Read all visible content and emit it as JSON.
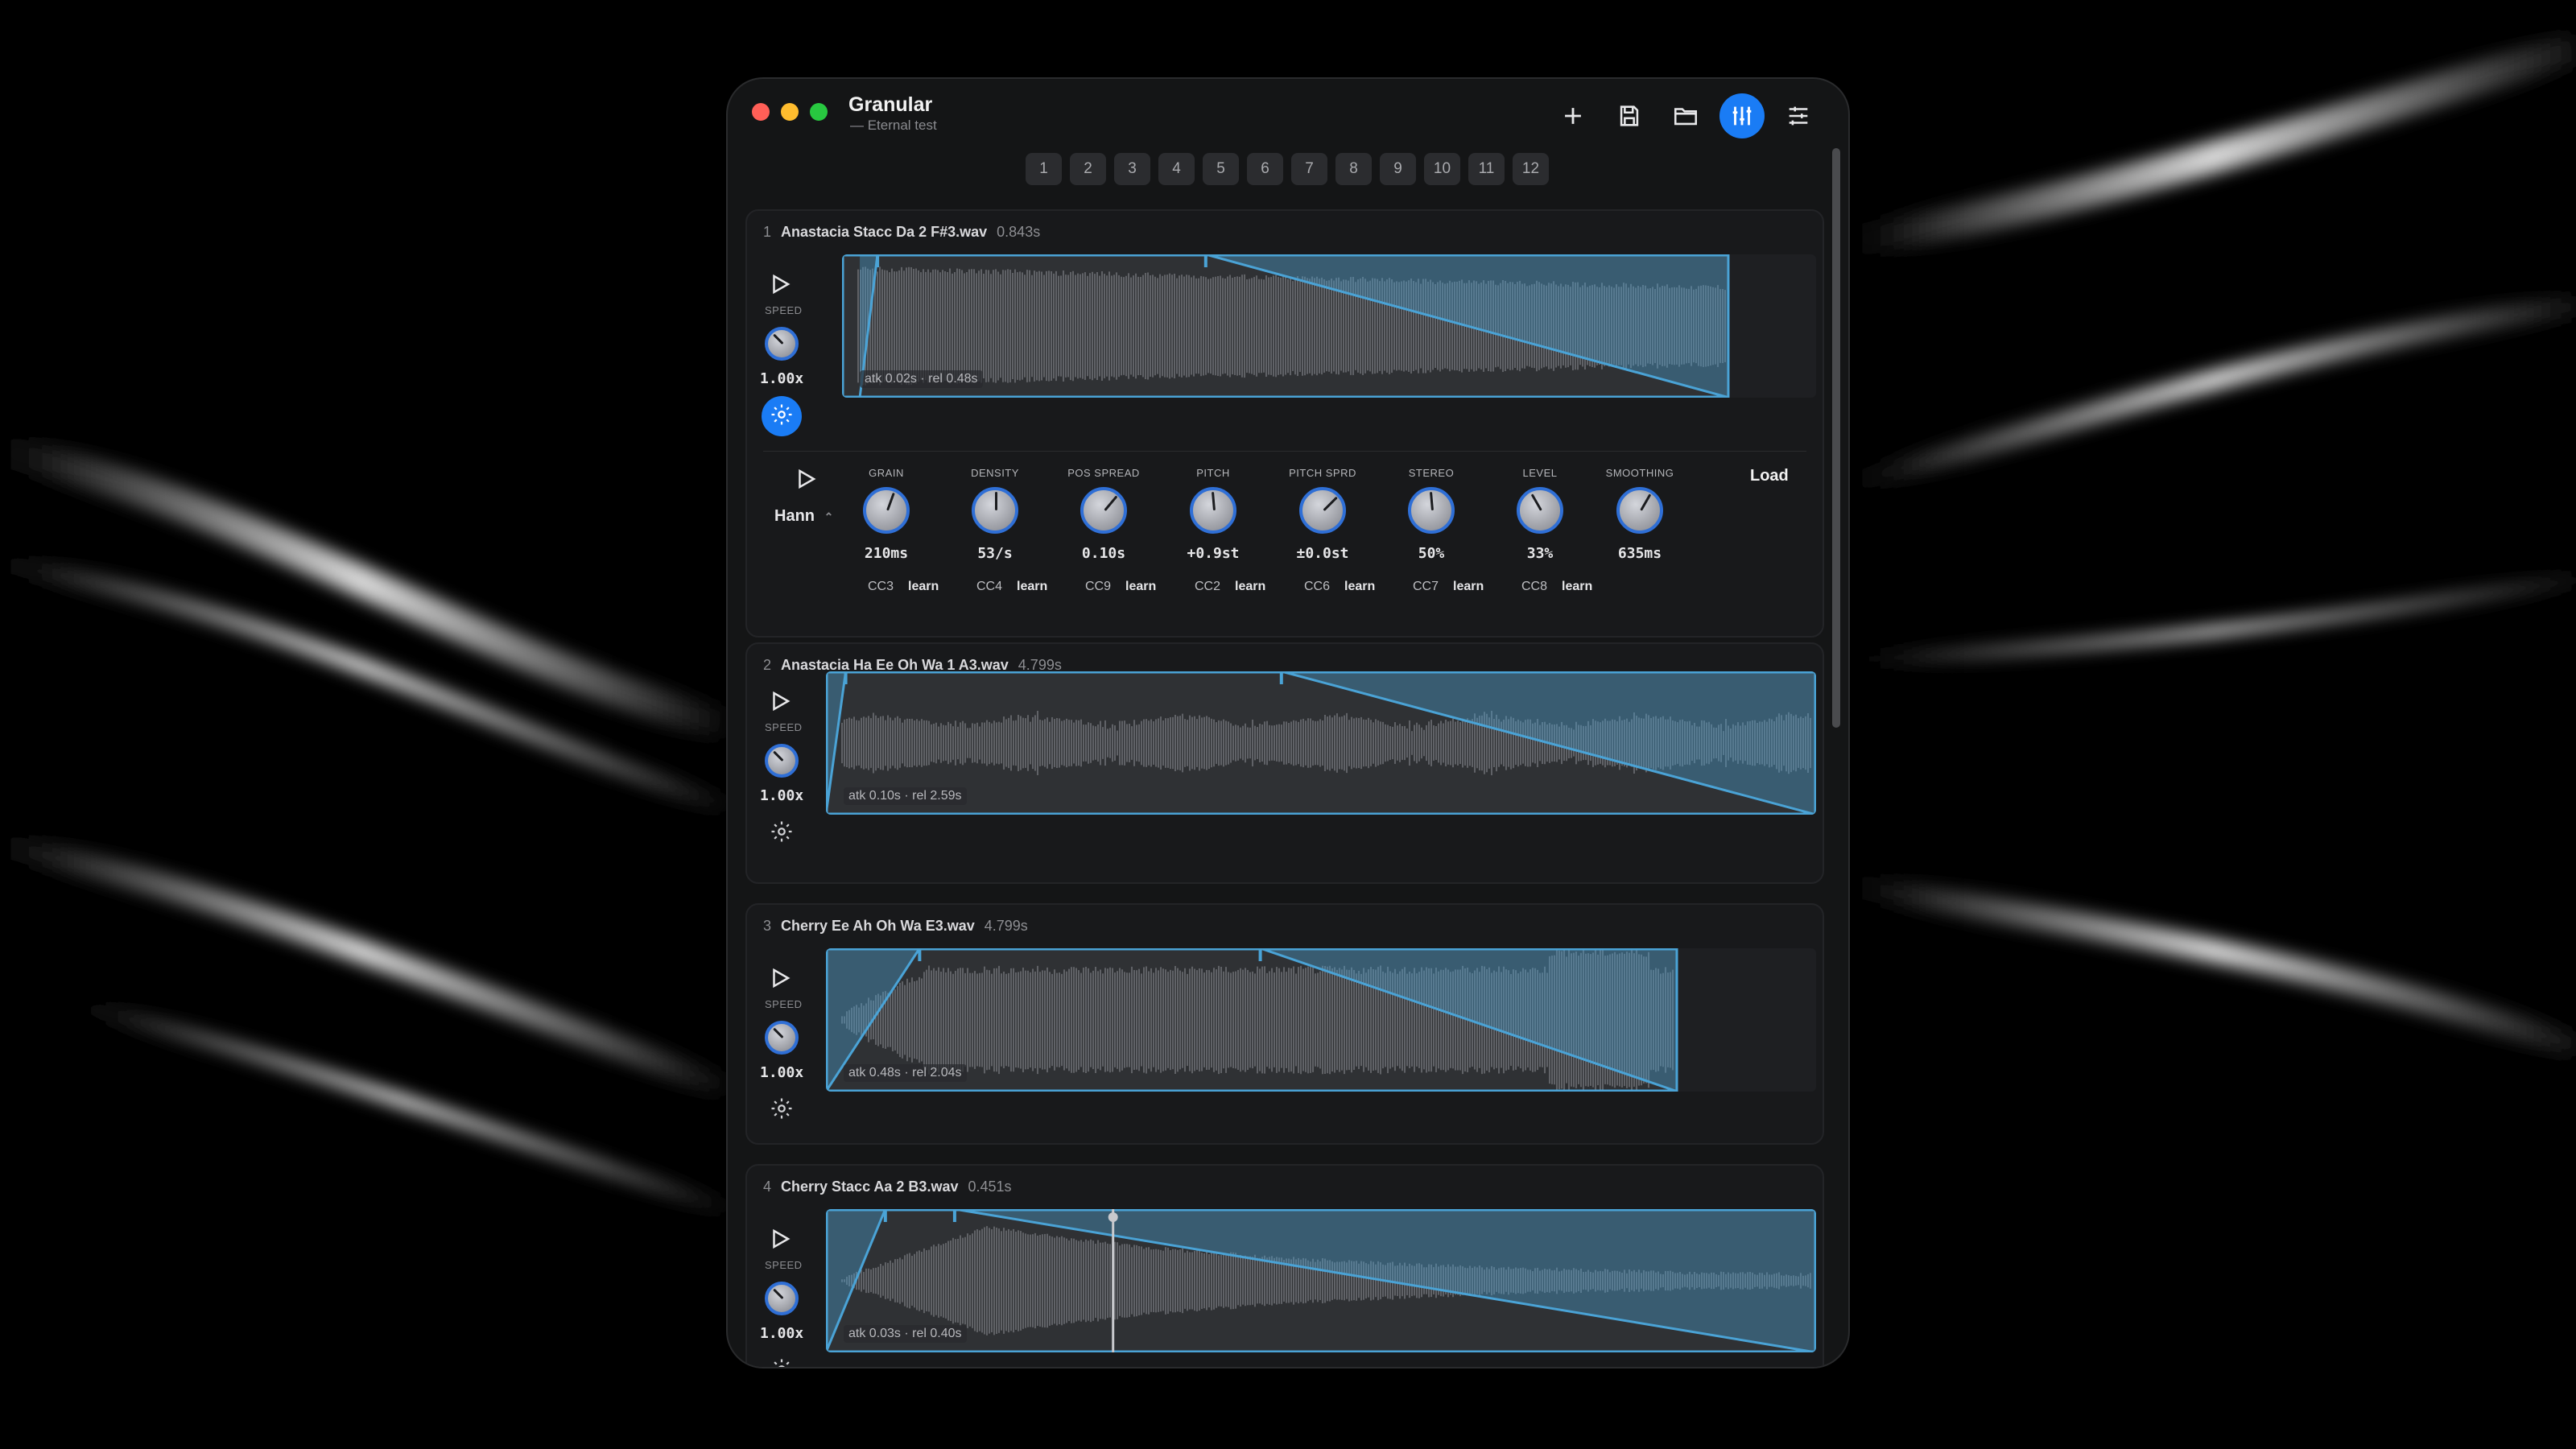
{
  "window": {
    "title": "Granular",
    "subtitle": "— Eternal test"
  },
  "toolbar": {
    "add_icon": "plus-icon",
    "save_icon": "save-icon",
    "open_icon": "folder-icon",
    "mixer_icon": "mixer-icon",
    "settings_icon": "sliders-icon"
  },
  "tabs": [
    "1",
    "2",
    "3",
    "4",
    "5",
    "6",
    "7",
    "8",
    "9",
    "10",
    "11",
    "12"
  ],
  "speed_label": "SPEED",
  "tracks": [
    {
      "num": "1",
      "name": "Anastacia Stacc Da 2 F#3.wav",
      "duration": "0.843s",
      "speed": "1.00x",
      "envelope": "atk 0.02s · rel 0.48s",
      "gear_active": true
    },
    {
      "num": "2",
      "name": "Anastacia Ha Ee Oh Wa 1 A3.wav",
      "duration": "4.799s",
      "speed": "1.00x",
      "envelope": "atk 0.10s · rel 2.59s",
      "gear_active": false
    },
    {
      "num": "3",
      "name": "Cherry Ee Ah Oh Wa E3.wav",
      "duration": "4.799s",
      "speed": "1.00x",
      "envelope": "atk 0.48s · rel 2.04s",
      "gear_active": false
    },
    {
      "num": "4",
      "name": "Cherry Stacc Aa 2 B3.wav",
      "duration": "0.451s",
      "speed": "1.00x",
      "envelope": "atk 0.03s · rel 0.40s",
      "gear_active": false
    }
  ],
  "granular": {
    "window_type": "Hann",
    "load_label": "Load",
    "controls": [
      {
        "label": "GRAIN",
        "value": "210ms",
        "cc": "CC3",
        "learn": "learn"
      },
      {
        "label": "DENSITY",
        "value": "53/s",
        "cc": "CC4",
        "learn": "learn"
      },
      {
        "label": "POS SPREAD",
        "value": "0.10s",
        "cc": "CC9",
        "learn": "learn"
      },
      {
        "label": "PITCH",
        "value": "+0.9st",
        "cc": "CC2",
        "learn": "learn"
      },
      {
        "label": "PITCH SPRD",
        "value": "±0.0st",
        "cc": "CC6",
        "learn": "learn"
      },
      {
        "label": "STEREO",
        "value": "50%",
        "cc": "CC7",
        "learn": "learn"
      },
      {
        "label": "LEVEL",
        "value": "33%",
        "cc": "CC8",
        "learn": "learn"
      },
      {
        "label": "SMOOTHING",
        "value": "635ms",
        "cc": "",
        "learn": ""
      }
    ]
  },
  "colors": {
    "accent": "#1a7cf5",
    "envelope": "#4aa3d6",
    "window_bg": "#141516"
  }
}
